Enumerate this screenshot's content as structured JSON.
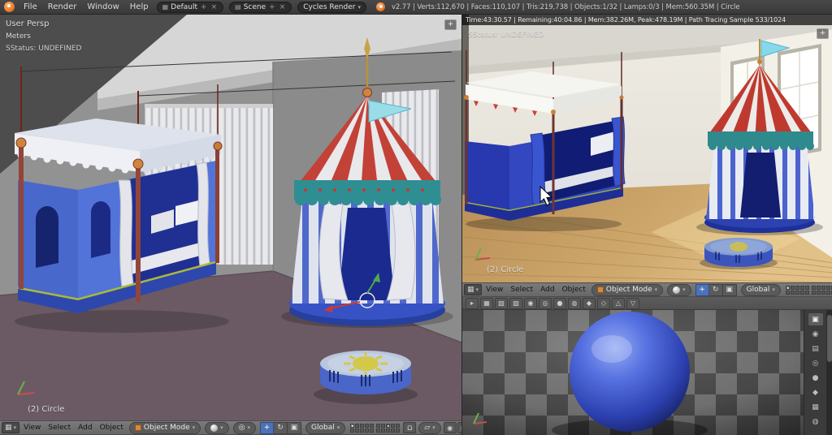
{
  "colors": {
    "accent_orange": "#e07c2c",
    "left_viewport_floor": "#6b5a64",
    "render_floor_wood": "#c9a66b",
    "material_sphere_blue": "#3a50c4",
    "header_bg": "#6f6f6f",
    "info_bar_bg": "#3e3e3e",
    "status_text": "#d8d8d8"
  },
  "glyphs": {
    "dropdown_arrow": "▾",
    "plus": "+",
    "close": "×",
    "editor_3d": "▦",
    "scene": "▤",
    "pivot": "◎",
    "translate": "+",
    "rotate": "↻",
    "scale": "▣",
    "magnet": "Ω",
    "snap_element": "▱",
    "render_still": "◉",
    "render_anim": "▶"
  },
  "info_bar": {
    "menus": [
      "File",
      "Render",
      "Window",
      "Help"
    ],
    "layout_name": "Default",
    "scene_name": "Scene",
    "engine": "Cycles Render",
    "stats": "v2.77 | Verts:112,670 | Faces:110,107 | Tris:219,738 | Objects:1/32 | Lamps:0/3 | Mem:560.35M | Circle"
  },
  "viewport_header": {
    "menus": [
      "View",
      "Select",
      "Add",
      "Object"
    ],
    "mode": "Object Mode",
    "orientation": "Global"
  },
  "left_viewport": {
    "view_name": "User Persp",
    "unit": "Meters",
    "status": "SStatus: UNDEFINED",
    "object_label": "(2) Circle"
  },
  "render_viewport": {
    "stats": "Time:43:30.57 | Remaining:40:04.86 | Mem:382.26M, Peak:478.19M | Path Tracing Sample 533/1024",
    "status": "SStatus: UNDEFINED",
    "object_label": "(2) Circle"
  },
  "preview_toolbar": {
    "icons": [
      "▸",
      "▦",
      "▧",
      "▨",
      "◉",
      "◎",
      "●",
      "◍",
      "◆",
      "◇",
      "△",
      "▽"
    ]
  },
  "properties_tabs": {
    "icons": [
      "▣",
      "◉",
      "▤",
      "◎",
      "●",
      "◆",
      "▦",
      "◍"
    ]
  }
}
